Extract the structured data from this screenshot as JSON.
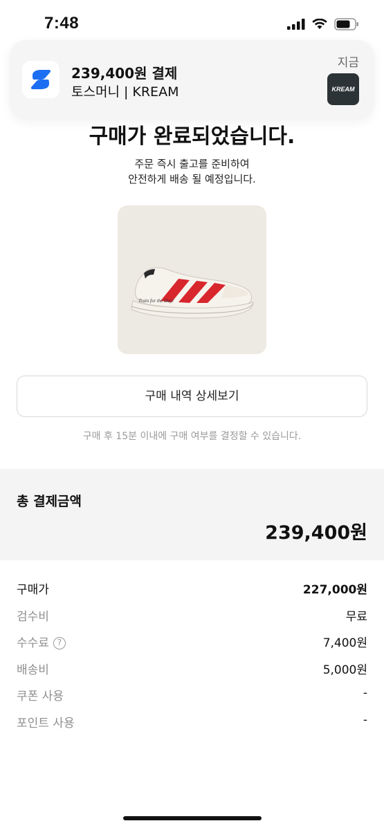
{
  "status_bar": {
    "time": "7:48"
  },
  "notification": {
    "title": "239,400원 결제",
    "body": "토스머니 | KREAM",
    "time": "지금",
    "thumb_text": "KREAM",
    "app_icon": "toss-logo-icon"
  },
  "main": {
    "title": "구매가 완료되었습니다.",
    "subtitle_line1": "주문 즉시 출고를 준비하여",
    "subtitle_line2": "안전하게 배송 될 예정입니다.",
    "detail_button": "구매 내역 상세보기",
    "note": "구매 후 15분 이내에 구매 여부를 결정할 수 있습니다."
  },
  "total": {
    "label": "총 결제금액",
    "amount": "239,400원"
  },
  "line_items": [
    {
      "label": "구매가",
      "value": "227,000원"
    },
    {
      "label": "검수비",
      "value": "무료"
    },
    {
      "label": "수수료",
      "value": "7,400원",
      "help": "?"
    },
    {
      "label": "배송비",
      "value": "5,000원"
    },
    {
      "label": "쿠폰 사용",
      "value": "-"
    },
    {
      "label": "포인트 사용",
      "value": "-"
    }
  ],
  "colors": {
    "accent_blue": "#1d6ff2",
    "shoe_red": "#d8262d"
  }
}
